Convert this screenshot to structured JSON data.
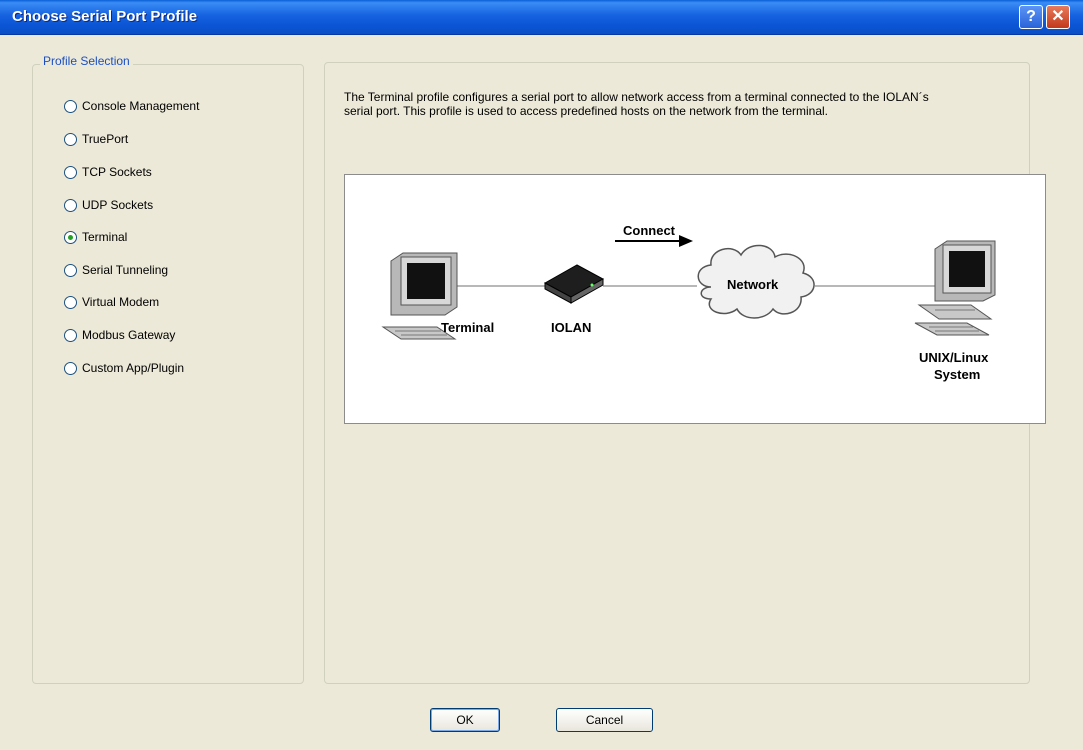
{
  "window": {
    "title": "Choose Serial Port Profile",
    "help_icon": "question-mark-icon",
    "close_icon": "close-x-icon"
  },
  "profile_selection": {
    "label": "Profile Selection",
    "selected": "Terminal",
    "options": [
      {
        "label": "Console Management",
        "checked": false
      },
      {
        "label": "TruePort",
        "checked": false
      },
      {
        "label": "TCP Sockets",
        "checked": false
      },
      {
        "label": "UDP Sockets",
        "checked": false
      },
      {
        "label": "Terminal",
        "checked": true
      },
      {
        "label": "Serial Tunneling",
        "checked": false
      },
      {
        "label": "Virtual Modem",
        "checked": false
      },
      {
        "label": "Modbus Gateway",
        "checked": false
      },
      {
        "label": "Custom App/Plugin",
        "checked": false
      }
    ]
  },
  "description": {
    "line1": "The Terminal profile configures a serial port to allow network access from a terminal connected to the IOLAN´s",
    "line2": "serial port. This profile is used to access predefined hosts on the network from the terminal."
  },
  "diagram": {
    "terminal_label": "Terminal",
    "iolan_label": "IOLAN",
    "connect_label": "Connect",
    "network_label": "Network",
    "system_label_line1": "UNIX/Linux",
    "system_label_line2": "System"
  },
  "buttons": {
    "ok": "OK",
    "cancel": "Cancel"
  }
}
